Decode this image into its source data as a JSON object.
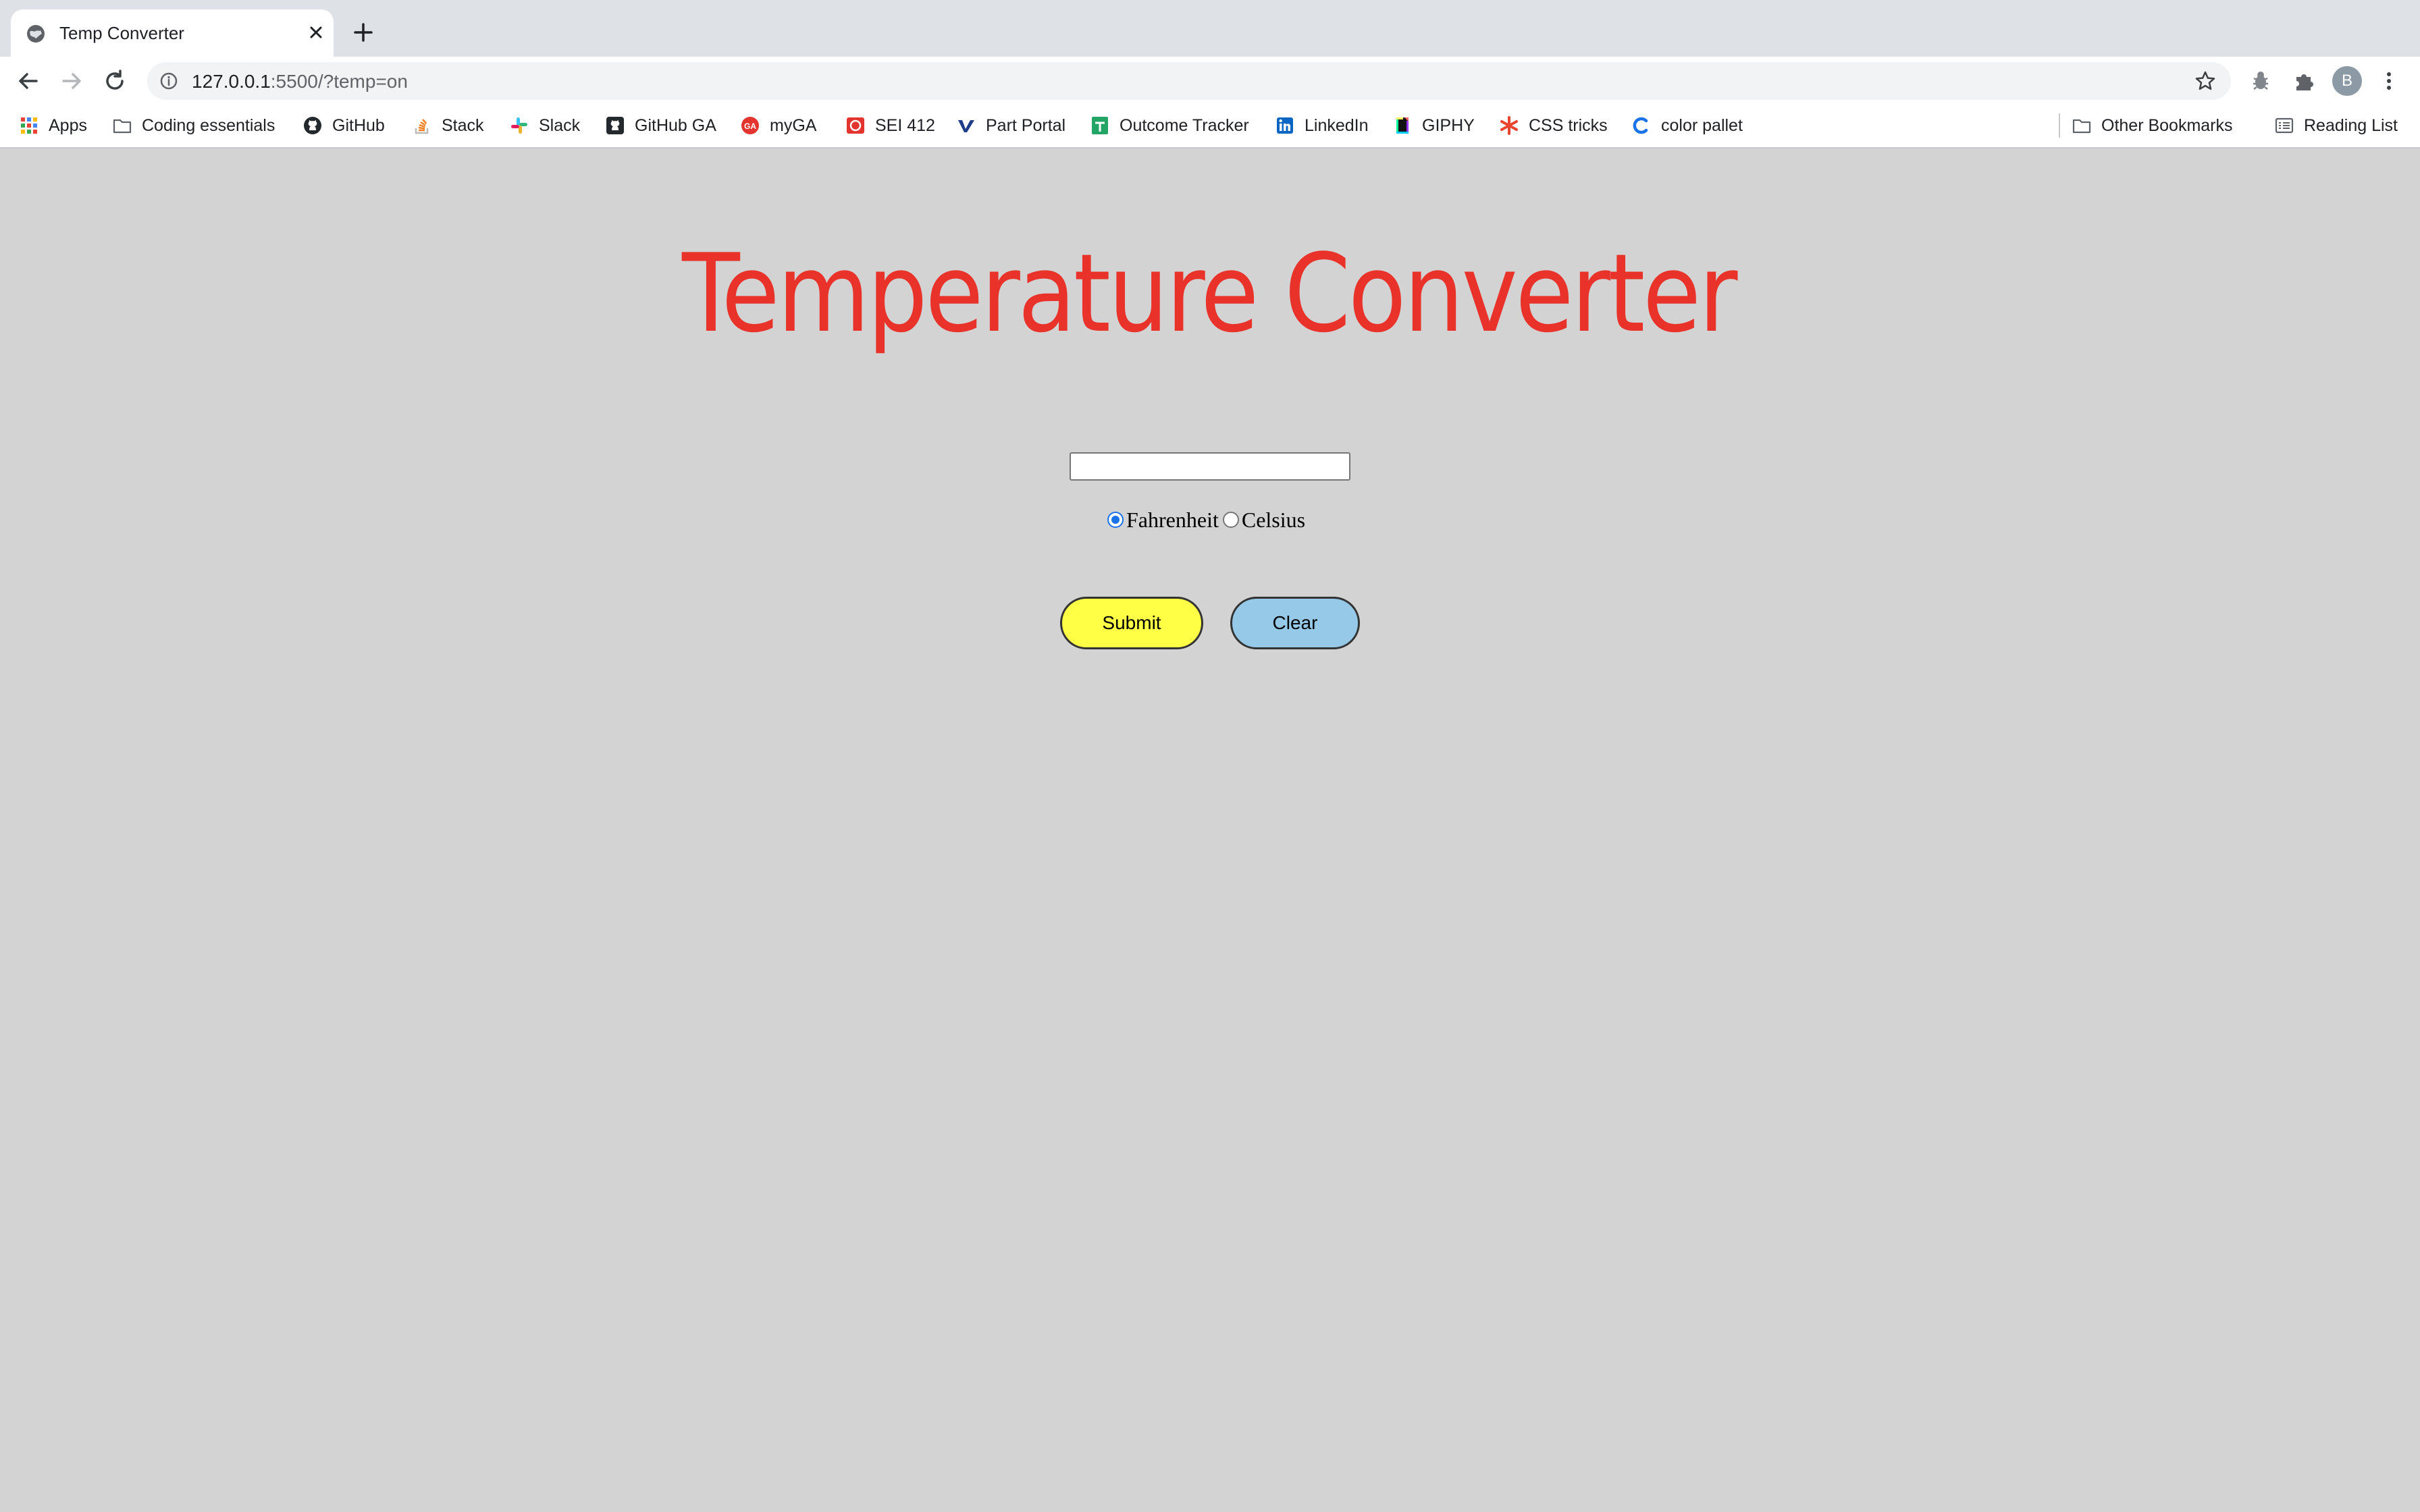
{
  "browser": {
    "tab": {
      "title": "Temp Converter"
    },
    "address": {
      "host": "127.0.0.1",
      "rest": ":5500/?temp=on"
    },
    "profile_initial": "B",
    "bookmarks": [
      {
        "label": "Apps",
        "icon": "apps-grid-icon"
      },
      {
        "label": "Coding essentials",
        "icon": "folder-icon"
      },
      {
        "label": "GitHub",
        "icon": "github-icon"
      },
      {
        "label": "Stack",
        "icon": "stack-overflow-icon"
      },
      {
        "label": "Slack",
        "icon": "slack-icon"
      },
      {
        "label": "GitHub GA",
        "icon": "github-icon"
      },
      {
        "label": "myGA",
        "icon": "ga-icon"
      },
      {
        "label": "SEI 412",
        "icon": "sei-icon"
      },
      {
        "label": "Part Portal",
        "icon": "part-portal-icon"
      },
      {
        "label": "Outcome Tracker",
        "icon": "sheets-icon"
      },
      {
        "label": "LinkedIn",
        "icon": "linkedin-icon"
      },
      {
        "label": "GIPHY",
        "icon": "giphy-icon"
      },
      {
        "label": "CSS tricks",
        "icon": "css-tricks-icon"
      },
      {
        "label": "color pallet",
        "icon": "color-pallet-icon"
      }
    ],
    "other_bookmarks": "Other Bookmarks",
    "reading_list": "Reading List"
  },
  "page": {
    "title": "Temperature Converter",
    "title_color": "#e8322a",
    "background": "#d3d3d3",
    "input_value": "",
    "radios": [
      {
        "label": "Fahrenheit",
        "checked": true
      },
      {
        "label": "Celsius",
        "checked": false
      }
    ],
    "submit_label": "Submit",
    "submit_color": "#ffff45",
    "clear_label": "Clear",
    "clear_color": "#96c8e8"
  }
}
